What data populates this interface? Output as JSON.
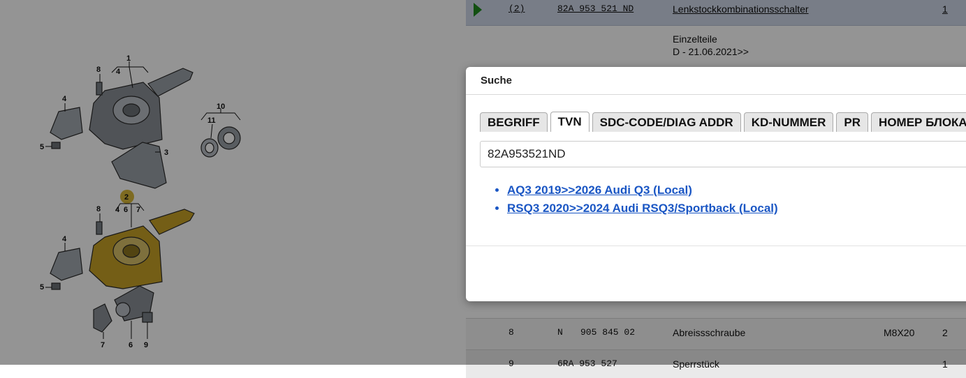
{
  "parts_table": {
    "selected_row": {
      "position": "(2)",
      "part_number": "82A 953 521 ND",
      "description": "Lenkstockkombinationsschalter",
      "quantity": "1"
    },
    "subheader": {
      "line1": "Einzelteile",
      "line2": "D - 21.06.2021>>"
    },
    "row_8": {
      "position": "8",
      "prefix": "N",
      "part_number": "905 845 02",
      "description": "Abreissschraube",
      "spec": "M8X20",
      "quantity": "2"
    },
    "row_9": {
      "position": "9",
      "part_number": "6RA 953 527",
      "description": "Sperrstück",
      "quantity": "1"
    }
  },
  "diagram": {
    "callouts": {
      "top": [
        "1",
        "4",
        "8",
        "4",
        "5",
        "3",
        "10",
        "11"
      ],
      "bottom": [
        "2",
        "8",
        "4",
        "6",
        "7",
        "4",
        "5",
        "7",
        "6",
        "9"
      ]
    },
    "highlight_color": "#c9a227"
  },
  "modal": {
    "title": "Suche",
    "tabs": [
      {
        "label": "BEGRIFF"
      },
      {
        "label": "TVN"
      },
      {
        "label": "SDC-CODE/DIAG ADDR"
      },
      {
        "label": "KD-NUMMER"
      },
      {
        "label": "PR"
      },
      {
        "label": "НОМЕР БЛОКА"
      }
    ],
    "search_value": "82A953521ND",
    "results": [
      {
        "label": "AQ3 2019>>2026 Audi Q3 (Local)"
      },
      {
        "label": "RSQ3 2020>>2024 Audi RSQ3/Sportback (Local)"
      }
    ]
  }
}
